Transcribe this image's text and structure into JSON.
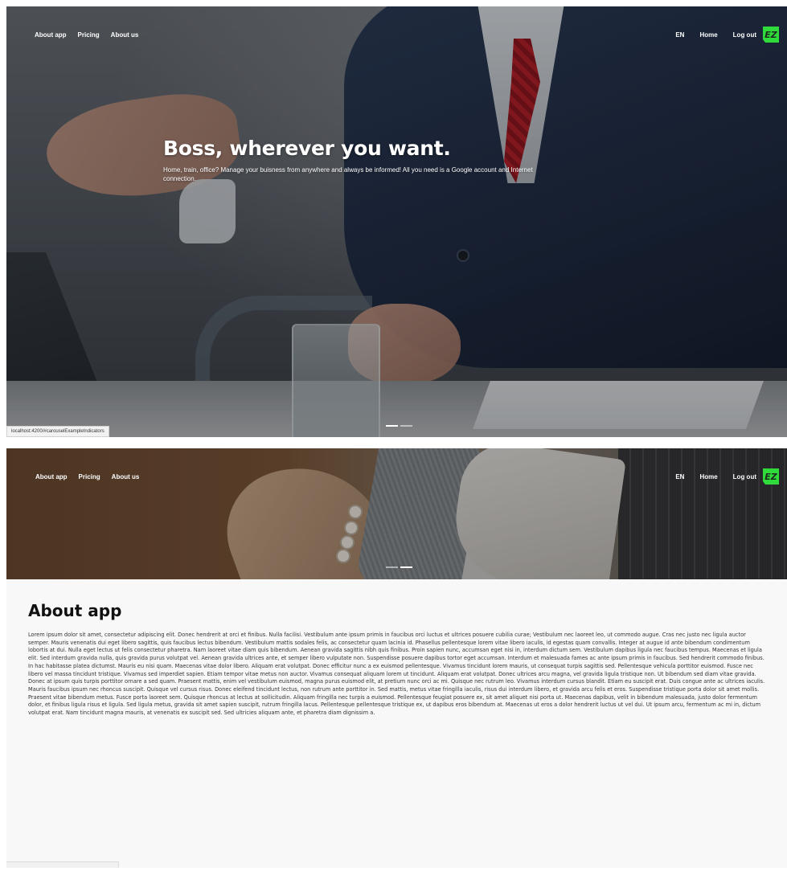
{
  "nav": {
    "left_links": [
      "About app",
      "Pricing",
      "About us"
    ],
    "lang": "EN",
    "home": "Home",
    "logout": "Log out",
    "logo_text": "EZ"
  },
  "hero": {
    "title": "Boss, wherever you want.",
    "subtitle": "Home, train, office? Manage your buisness from anywhere and always be informed! All you need is a Google account and Internet connection."
  },
  "carousel": {
    "slide_count": 2,
    "active_index": 0
  },
  "carousel2": {
    "active_index": 1
  },
  "status_bar": {
    "url": "localhost:4200/#carouselExampleIndicators"
  },
  "about": {
    "heading": "About app",
    "body": "Lorem ipsum dolor sit amet, consectetur adipiscing elit. Donec hendrerit at orci et finibus. Nulla facilisi. Vestibulum ante ipsum primis in faucibus orci luctus et ultrices posuere cubilia curae; Vestibulum nec laoreet leo, ut commodo augue. Cras nec justo nec ligula auctor semper. Mauris venenatis dui eget libero sagittis, quis faucibus lectus bibendum. Vestibulum mattis sodales felis, ac consectetur quam lacinia id. Phasellus pellentesque lorem vitae libero iaculis, id egestas quam convallis. Integer at augue id ante bibendum condimentum lobortis at dui. Nulla eget lectus ut felis consectetur pharetra. Nam laoreet vitae diam quis bibendum. Aenean gravida sagittis nibh quis finibus. Proin sapien nunc, accumsan eget nisi in, interdum dictum sem. Vestibulum dapibus ligula nec faucibus tempus. Maecenas et ligula elit. Sed interdum gravida nulla, quis gravida purus volutpat vel. Aenean gravida ultrices ante, et semper libero vulputate non. Suspendisse posuere dapibus tortor eget accumsan. Interdum et malesuada fames ac ante ipsum primis in faucibus. Sed hendrerit commodo finibus. In hac habitasse platea dictumst. Mauris eu nisi quam. Maecenas vitae dolor libero. Aliquam erat volutpat. Donec efficitur nunc a ex euismod pellentesque. Vivamus tincidunt lorem mauris, ut consequat turpis sagittis sed. Pellentesque vehicula porttitor euismod. Fusce nec libero vel massa tincidunt tristique. Vivamus sed imperdiet sapien. Etiam tempor vitae metus non auctor. Vivamus consequat aliquam lorem ut tincidunt. Aliquam erat volutpat. Donec ultrices arcu magna, vel gravida ligula tristique non. Ut bibendum sed diam vitae gravida. Donec at ipsum quis turpis porttitor ornare a sed quam. Praesent mattis, enim vel vestibulum euismod, magna purus euismod elit, at pretium nunc orci ac mi. Quisque nec rutrum leo. Vivamus interdum cursus blandit. Etiam eu suscipit erat. Duis congue ante ac ultrices iaculis. Mauris faucibus ipsum nec rhoncus suscipit. Quisque vel cursus risus. Donec eleifend tincidunt lectus, non rutrum ante porttitor in. Sed mattis, metus vitae fringilla iaculis, risus dui interdum libero, et gravida arcu felis et eros. Suspendisse tristique porta dolor sit amet mollis. Praesent vitae bibendum metus. Fusce porta laoreet sem. Quisque rhoncus at lectus at sollicitudin. Aliquam fringilla nec turpis a euismod. Pellentesque feugiat posuere ex, sit amet aliquet nisi porta ut. Maecenas dapibus, velit in bibendum malesuada, justo dolor fermentum dolor, et finibus ligula risus et ligula. Sed ligula metus, gravida sit amet sapien suscipit, rutrum fringilla lacus. Pellentesque pellentesque tristique ex, ut dapibus eros bibendum at. Maecenas ut eros a dolor hendrerit luctus ut vel dui. Ut ipsum arcu, fermentum ac mi in, dictum volutpat erat. Nam tincidunt magna mauris, at venenatis ex suscipit sed. Sed ultricies aliquam ante, et pharetra diam dignissim a."
  },
  "icons": {
    "logo": "ez-logo-icon"
  },
  "colors": {
    "logo_green": "#2fdb3a",
    "nav_text": "#ffffff",
    "page_bg": "#f8f8f8"
  }
}
